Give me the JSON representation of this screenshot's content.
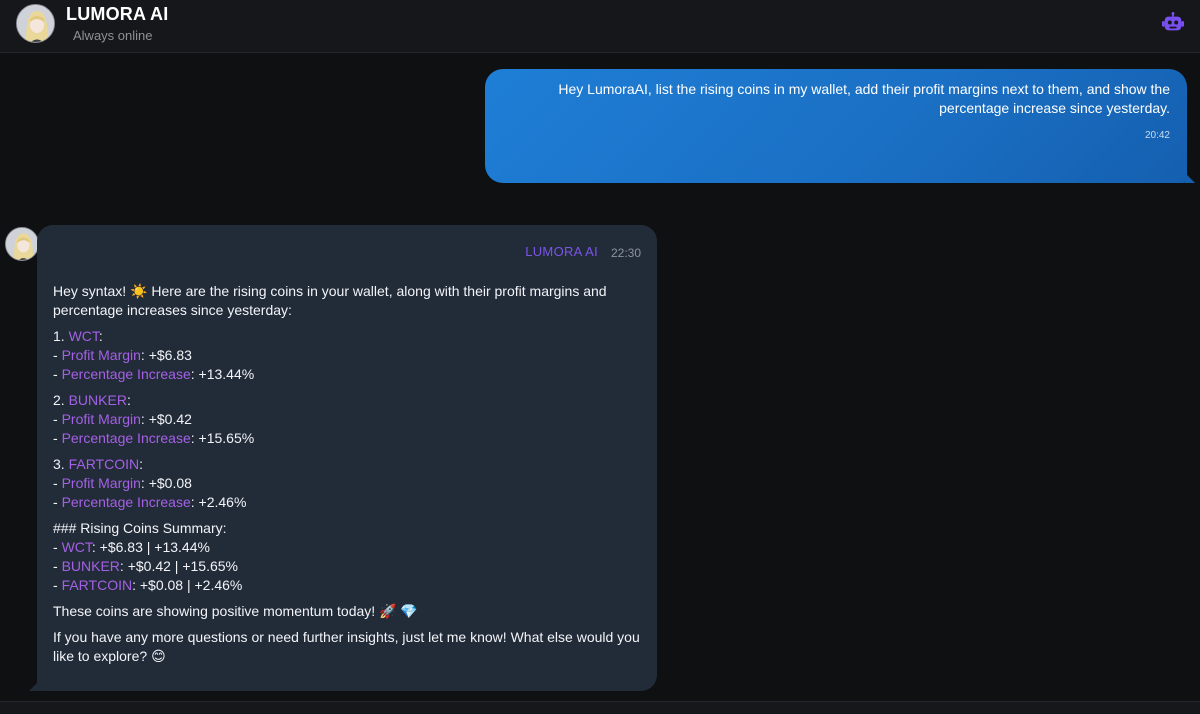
{
  "header": {
    "title": "LUMORA AI",
    "status": "Always online",
    "bot_icon": "robot-icon"
  },
  "colors": {
    "accent_purple": "#a461e6",
    "bot_name": "#7b55e8",
    "user_bubble": "#1a6fc3",
    "bot_bubble": "#222b38"
  },
  "messages": {
    "user": {
      "text": "Hey LumoraAI, list the rising coins in my wallet, add their profit margins next to them, and show the percentage increase since yesterday.",
      "time": "20:42"
    },
    "bot": {
      "name": "LUMORA AI",
      "time": "22:30",
      "intro_pre": "Hey syntax!",
      "intro_emoji": "☀️",
      "intro_post": "Here are the rising coins in your wallet, along with their profit margins and percentage increases since yesterday:",
      "profit_label": "Profit Margin",
      "pct_label": "Percentage Increase",
      "coins": [
        {
          "num": "1.",
          "name": "WCT",
          "profit": "+$6.83",
          "pct": "+13.44%"
        },
        {
          "num": "2.",
          "name": "BUNKER",
          "profit": "+$0.42",
          "pct": "+15.65%"
        },
        {
          "num": "3.",
          "name": "FARTCOIN",
          "profit": "+$0.08",
          "pct": "+2.46%"
        }
      ],
      "summary_heading": "### Rising Coins Summary:",
      "summary": [
        {
          "name": "WCT",
          "value": "+$6.83 | +13.44%"
        },
        {
          "name": "BUNKER",
          "value": "+$0.42 | +15.65%"
        },
        {
          "name": "FARTCOIN",
          "value": "+$0.08 | +2.46%"
        }
      ],
      "momentum": "These coins are showing positive momentum today!",
      "momentum_emojis": "🚀 💎",
      "closing": "If you have any more questions or need further insights, just let me know! What else would you like to explore?",
      "closing_emoji": "😊"
    }
  }
}
